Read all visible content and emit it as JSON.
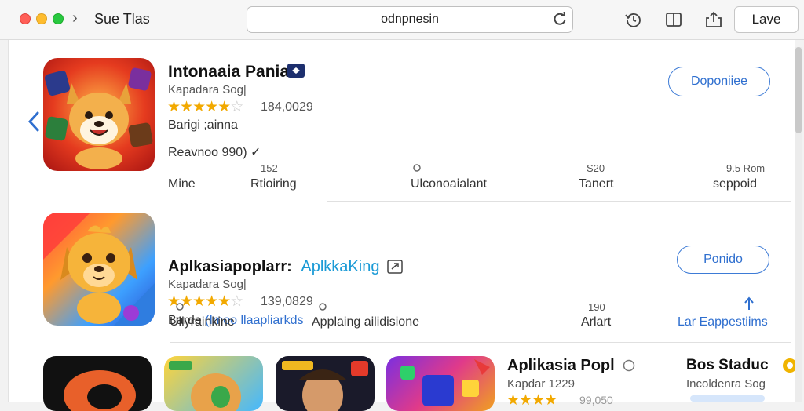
{
  "window": {
    "title": "Sue   Tlas",
    "url": "odnpnesin",
    "save_label": "Lave"
  },
  "apps": [
    {
      "name": "Intonaaia Pania",
      "developer": "Kapadara Sog|",
      "rating_value": 4.5,
      "rating_count": "184,0029",
      "category_line": "Barigi ;ainna",
      "extra_line": "Reavnoo 990) ✓",
      "action_label": "Doponiiee",
      "stats": [
        {
          "top": "152",
          "bottom": "Mine"
        },
        {
          "top": "",
          "bottom": "Rtioiring"
        },
        {
          "top": "",
          "bottom": "Ulconoaialant"
        },
        {
          "top": "S20",
          "bottom": "Tanert"
        },
        {
          "top": "9.5 Rom",
          "bottom": "seppoid"
        }
      ]
    },
    {
      "name": "Aplkasiapoplarr:",
      "name_suffix": "AplkkaKing",
      "developer": "Kapadara Sog|",
      "rating_value": 4.5,
      "rating_count": "139,0829",
      "category_line": "Barde",
      "category_link": "(Imoo llaapliarkds",
      "action_label": "Ponido",
      "stats": [
        {
          "top": "",
          "bottom": "Ullyrainkine"
        },
        {
          "top": "",
          "bottom": "Applaing ailidisione"
        },
        {
          "top": "190",
          "bottom": "Arlart"
        },
        {
          "top": "",
          "bottom": "Lar Eappestiims"
        }
      ]
    },
    {
      "name": "Aplikasia Popl",
      "developer": "Kapdar 1229",
      "rating_value": 4.5,
      "rating_count": "99,050",
      "side_name": "Bos Staduc",
      "side_sub": "Incoldenra Sog"
    }
  ],
  "colors": {
    "accent": "#2f6fcf",
    "star": "#f2a900",
    "link": "#1a9ad6"
  }
}
